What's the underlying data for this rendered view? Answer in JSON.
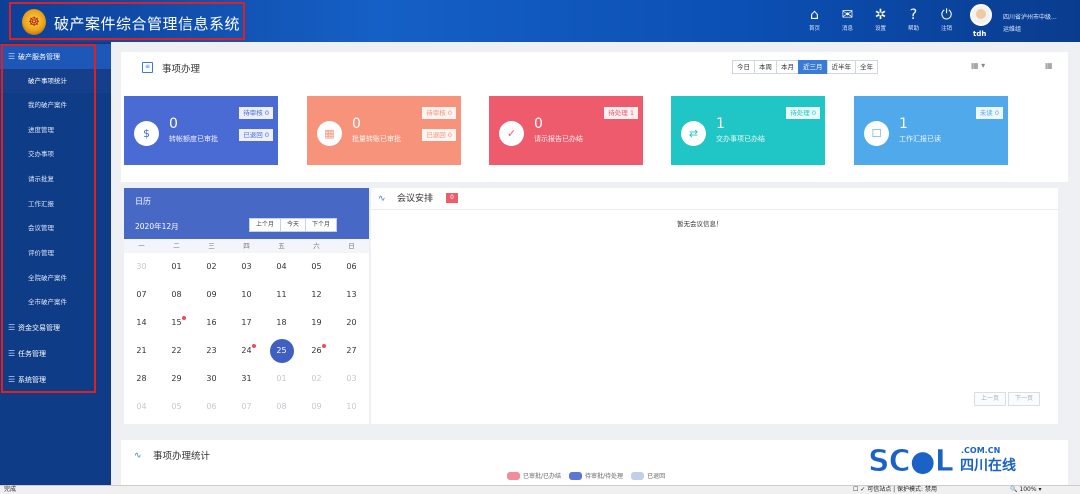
{
  "header": {
    "system_title": "破产案件综合管理信息系统",
    "emblem_glyph": "☸",
    "nav": [
      {
        "icon": "home-icon",
        "glyph": "⌂",
        "label": "首页"
      },
      {
        "icon": "mail-icon",
        "glyph": "✉",
        "label": "消息"
      },
      {
        "icon": "gear-icon",
        "glyph": "✲",
        "label": "设置"
      },
      {
        "icon": "help-icon",
        "glyph": "?",
        "label": "帮助"
      },
      {
        "icon": "power-icon",
        "glyph": "⏻",
        "label": "注销"
      }
    ],
    "username": "tdh",
    "org_line1": "四川省泸州市中级...",
    "org_line2": "运维组"
  },
  "sidebar": {
    "group_active": "破产服务管理",
    "items": [
      "破产事项统计",
      "我的破产案件",
      "进度管理",
      "交办事项",
      "请示批复",
      "工作汇报",
      "会议管理",
      "评价管理",
      "全院破产案件",
      "全市破产案件"
    ],
    "groups": [
      "资金交易管理",
      "任务管理",
      "系统管理"
    ]
  },
  "task_panel": {
    "title": "事项办理",
    "list_icon_glyph": "≡",
    "date_tabs": [
      "今日",
      "本周",
      "本月",
      "近三月",
      "近半年",
      "全年"
    ],
    "active_tab": "近三月",
    "calendar_ctrl": "▦ ▾",
    "grid_ctrl": "▦"
  },
  "stat_cards": [
    {
      "num": "0",
      "label": "转帐额度已审批",
      "badges": [
        "待审核 0",
        "已退回 0"
      ],
      "color": "#4a6bd4",
      "icon": "money-bag-icon",
      "glyph": "$"
    },
    {
      "num": "0",
      "label": "批量转账已审批",
      "badges": [
        "待审核 0",
        "已退回 0"
      ],
      "color": "#f6937a",
      "icon": "grid-apps-icon",
      "glyph": "▦"
    },
    {
      "num": "0",
      "label": "请示报告已办结",
      "badges": [
        "待处理 1"
      ],
      "color": "#ee5b6d",
      "icon": "clipboard-check-icon",
      "glyph": "✓"
    },
    {
      "num": "1",
      "label": "交办事项已办结",
      "badges": [
        "待处理 0"
      ],
      "color": "#20c5c5",
      "icon": "sync-icon",
      "glyph": "⇄"
    },
    {
      "num": "1",
      "label": "工作汇报已读",
      "badges": [
        "未读 0"
      ],
      "color": "#4fa9ea",
      "icon": "chat-report-icon",
      "glyph": "☐"
    }
  ],
  "calendar": {
    "title": "日历",
    "month": "2020年12月",
    "buttons": [
      "上个月",
      "今天",
      "下个月"
    ],
    "weekdays": [
      "一",
      "二",
      "三",
      "四",
      "五",
      "六",
      "日"
    ],
    "rows": [
      [
        "30",
        "01",
        "02",
        "03",
        "04",
        "05",
        "06"
      ],
      [
        "07",
        "08",
        "09",
        "10",
        "11",
        "12",
        "13"
      ],
      [
        "14",
        "15",
        "16",
        "17",
        "18",
        "19",
        "20"
      ],
      [
        "21",
        "22",
        "23",
        "24",
        "25",
        "26",
        "27"
      ],
      [
        "28",
        "29",
        "30",
        "31",
        "01",
        "02",
        "03"
      ],
      [
        "04",
        "05",
        "06",
        "07",
        "08",
        "09",
        "10"
      ]
    ],
    "today": "25",
    "event_days": [
      "15",
      "24",
      "26"
    ]
  },
  "meeting": {
    "title": "会议安排",
    "pulse_glyph": "∿",
    "count": "0",
    "empty_text": "暂无会议信息！",
    "pager": [
      "上一页",
      "下一页"
    ]
  },
  "stats": {
    "title": "事项办理统计",
    "pulse_glyph": "∿",
    "legend": [
      {
        "label": "已审批/已办结",
        "color": "#f28c9a"
      },
      {
        "label": "待审批/待处理",
        "color": "#5b76d3"
      },
      {
        "label": "已退回",
        "color": "#c3cfe8"
      }
    ]
  },
  "statusbar": {
    "left": "完成",
    "mid": "☐ ✓ 可信站点 | 保护模式: 禁用",
    "zoom": "🔍 100%  ▾"
  },
  "watermark": {
    "brand": "SC●L",
    "domain": ".COM.CN",
    "name": "四川在线"
  }
}
